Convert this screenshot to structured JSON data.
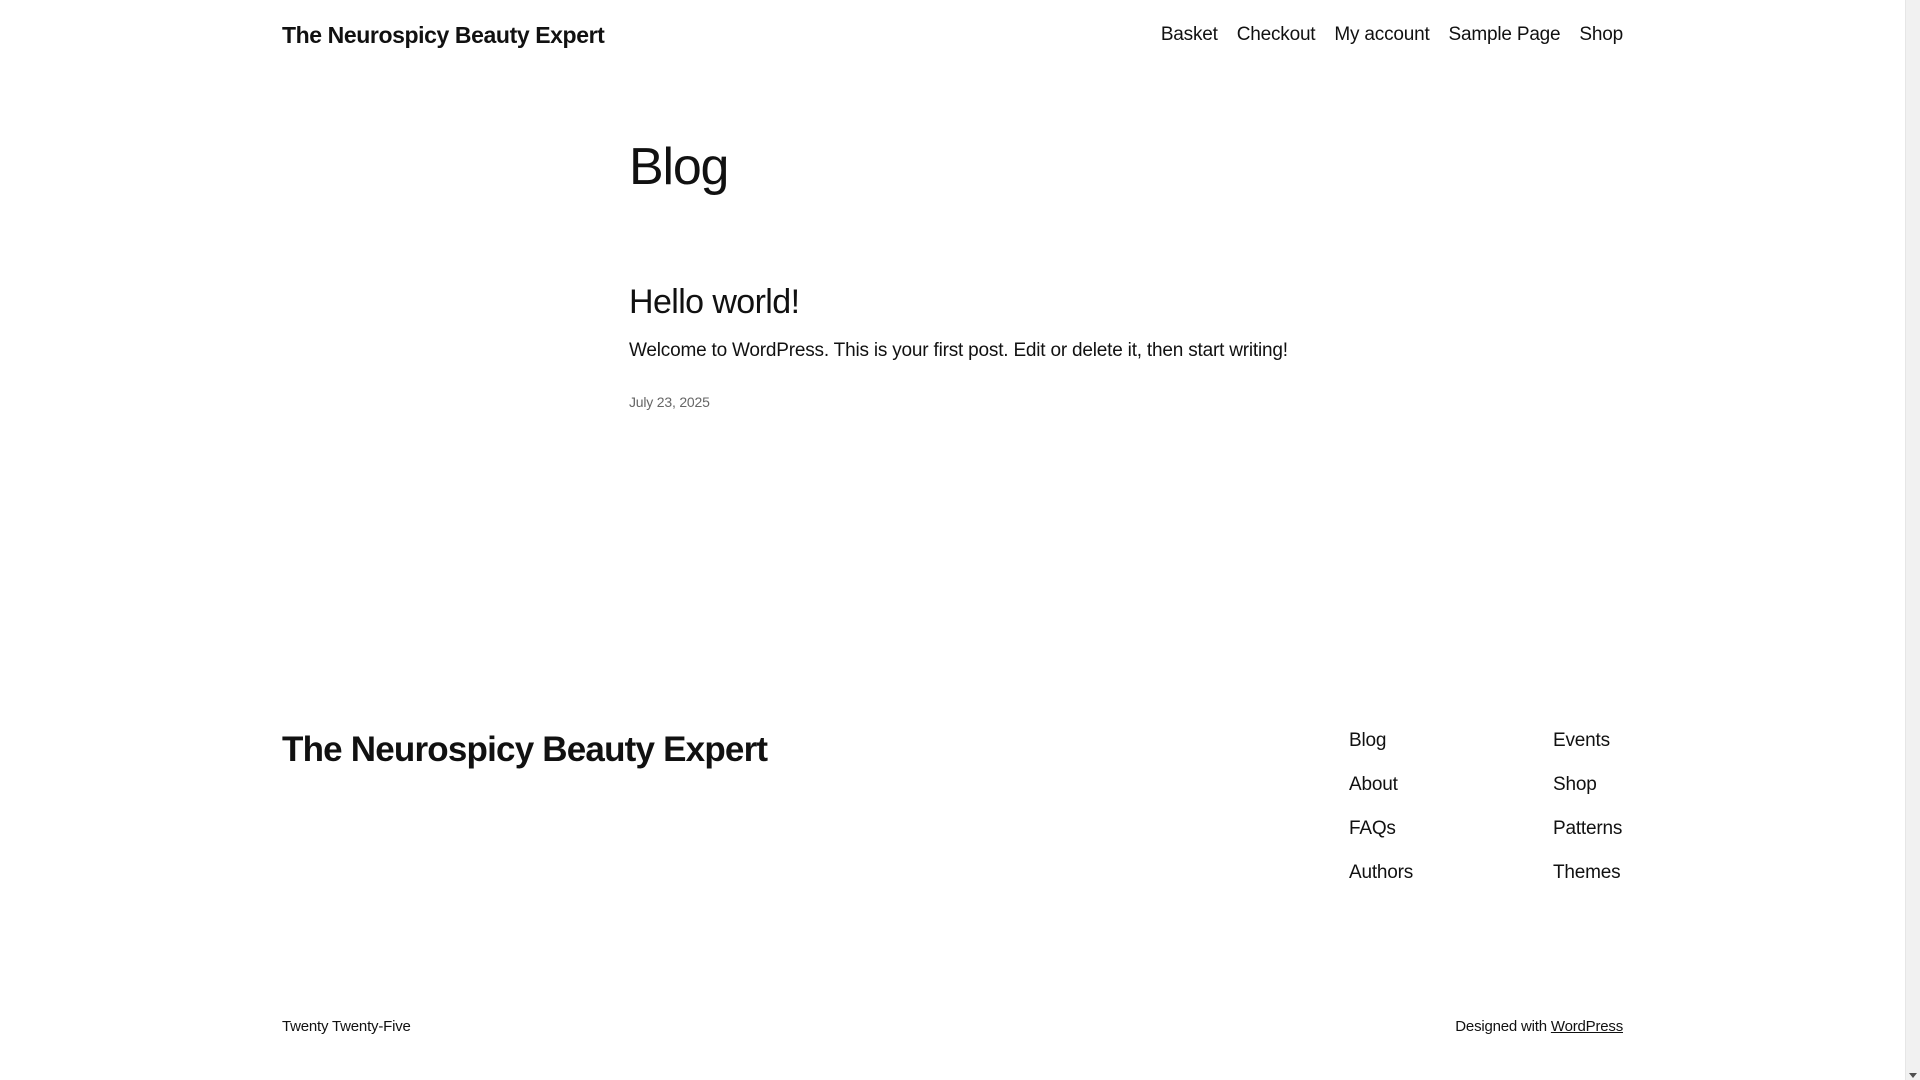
{
  "header": {
    "site_title": "The Neurospicy Beauty Expert",
    "nav": [
      "Basket",
      "Checkout",
      "My account",
      "Sample Page",
      "Shop"
    ]
  },
  "main": {
    "heading": "Blog",
    "post": {
      "title": "Hello world!",
      "excerpt": "Welcome to WordPress. This is your first post. Edit or delete it, then start writing!",
      "date": "July 23, 2025"
    }
  },
  "footer": {
    "site_title": "The Neurospicy Beauty Expert",
    "col1": [
      "Blog",
      "About",
      "FAQs",
      "Authors"
    ],
    "col2": [
      "Events",
      "Shop",
      "Patterns",
      "Themes"
    ],
    "theme_credit": "Twenty Twenty-Five",
    "designed_with": "Designed with",
    "designed_link": "WordPress"
  }
}
